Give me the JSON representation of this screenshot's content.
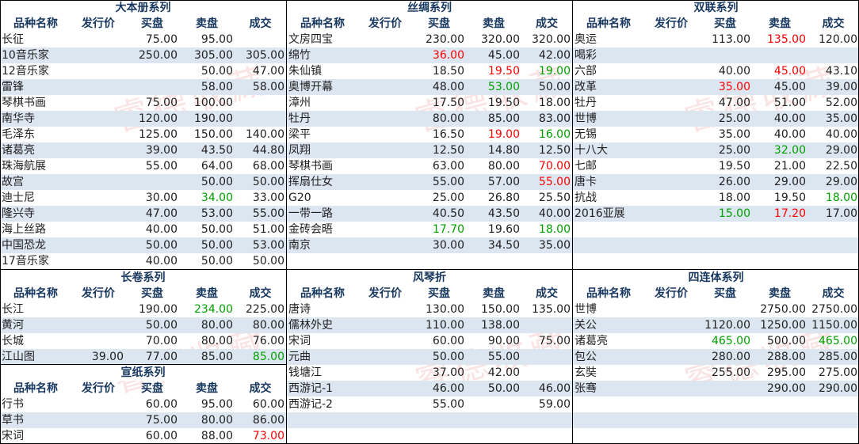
{
  "headers": {
    "name": "品种名称",
    "issue": "发行价",
    "buy": "买盘",
    "sell": "卖盘",
    "deal": "成交"
  },
  "watermark": "睿德收藏",
  "colors": {
    "header_text": "#17375e",
    "alt_row": "#dce6f1",
    "red": "#ff0000",
    "green": "#00a000"
  },
  "sections": [
    {
      "title": "大本册系列",
      "rows": [
        [
          "长征",
          "",
          "75.00",
          "95.00",
          ""
        ],
        [
          "10音乐家",
          "",
          "250.00",
          "305.00",
          "305.00"
        ],
        [
          "12音乐家",
          "",
          "",
          "50.00",
          "47.00"
        ],
        [
          "雷锋",
          "",
          "",
          "58.00",
          "58.00"
        ],
        [
          "琴棋书画",
          "",
          "75.00",
          "100.00",
          ""
        ],
        [
          "南华寺",
          "",
          "120.00",
          "190.00",
          ""
        ],
        [
          "毛泽东",
          "",
          "125.00",
          "150.00",
          "140.00"
        ],
        [
          "诸葛亮",
          "",
          "39.00",
          "43.50",
          "44.80"
        ],
        [
          "珠海航展",
          "",
          "55.00",
          "64.00",
          "68.00"
        ],
        [
          "故宫",
          "",
          "",
          "50.00",
          "50.00"
        ],
        [
          "迪士尼",
          "",
          "30.00",
          "34.00",
          "33.00"
        ],
        [
          "隆兴寺",
          "",
          "47.00",
          "53.00",
          "55.00"
        ],
        [
          "海上丝路",
          "",
          "40.00",
          "50.00",
          "51.00"
        ],
        [
          "中国恐龙",
          "",
          "50.00",
          "50.00",
          "53.00"
        ],
        [
          "17音乐家",
          "",
          "40.00",
          "50.00",
          "50.00"
        ]
      ],
      "colors": {
        "10-3": "green"
      }
    },
    {
      "title": "丝绸系列",
      "rows": [
        [
          "文房四宝",
          "",
          "230.00",
          "320.00",
          "320.00"
        ],
        [
          "绵竹",
          "",
          "36.00",
          "45.00",
          "42.00"
        ],
        [
          "朱仙镇",
          "",
          "18.50",
          "19.50",
          "19.00"
        ],
        [
          "奥博开幕",
          "",
          "48.00",
          "53.00",
          "50.00"
        ],
        [
          "漳州",
          "",
          "17.50",
          "19.50",
          "18.00"
        ],
        [
          "牡丹",
          "",
          "80.00",
          "85.00",
          "83.00"
        ],
        [
          "梁平",
          "",
          "16.50",
          "19.00",
          "16.00"
        ],
        [
          "凤翔",
          "",
          "12.50",
          "14.80",
          "12.50"
        ],
        [
          "琴棋书画",
          "",
          "63.00",
          "80.00",
          "70.00"
        ],
        [
          "挥扇仕女",
          "",
          "55.00",
          "57.00",
          "55.00"
        ],
        [
          "G20",
          "",
          "25.00",
          "26.80",
          "25.50"
        ],
        [
          "一带一路",
          "",
          "40.50",
          "43.50",
          "40.00"
        ],
        [
          "金砖会晤",
          "",
          "17.70",
          "19.60",
          "18.00"
        ],
        [
          "南京",
          "",
          "30.00",
          "34.50",
          "35.00"
        ]
      ],
      "colors": {
        "1-2": "red",
        "2-3": "red",
        "2-4": "green",
        "3-3": "green",
        "6-3": "red",
        "6-4": "green",
        "8-4": "red",
        "9-4": "red",
        "12-2": "green",
        "12-4": "green"
      }
    },
    {
      "title": "双联系列",
      "rows": [
        [
          "奥运",
          "",
          "113.00",
          "135.00",
          "120.00"
        ],
        [
          "喝彩",
          "",
          "",
          "",
          ""
        ],
        [
          "六部",
          "",
          "40.00",
          "45.00",
          "43.10"
        ],
        [
          "改革",
          "",
          "35.00",
          "45.00",
          "39.00"
        ],
        [
          "牡丹",
          "",
          "47.00",
          "51.00",
          "52.00"
        ],
        [
          "世博",
          "",
          "25.00",
          "40.00",
          "35.00"
        ],
        [
          "无锡",
          "",
          "35.00",
          "40.00",
          "40.00"
        ],
        [
          "十八大",
          "",
          "25.00",
          "32.00",
          "29.00"
        ],
        [
          "七邮",
          "",
          "19.50",
          "21.00",
          "22.50"
        ],
        [
          "唐卡",
          "",
          "26.00",
          "29.00",
          "29.00"
        ],
        [
          "抗战",
          "",
          "18.00",
          "19.50",
          "18.00"
        ],
        [
          "2016亚展",
          "",
          "15.00",
          "17.20",
          "17.00"
        ]
      ],
      "colors": {
        "0-3": "red",
        "2-3": "red",
        "3-2": "red",
        "7-3": "green",
        "10-4": "green",
        "11-2": "green",
        "11-3": "red"
      }
    },
    {
      "title": "长卷系列",
      "rows": [
        [
          "长江",
          "",
          "190.00",
          "234.00",
          "225.00"
        ],
        [
          "黄河",
          "",
          "50.00",
          "80.00",
          "80.00"
        ],
        [
          "长城",
          "",
          "70.00",
          "80.00",
          "76.00"
        ],
        [
          "江山图",
          "39.00",
          "77.00",
          "85.00",
          "85.00"
        ]
      ],
      "colors": {
        "0-3": "green",
        "3-4": "green"
      }
    },
    {
      "title": "宣纸系列",
      "rows": [
        [
          "行书",
          "",
          "60.00",
          "95.00",
          "60.00"
        ],
        [
          "草书",
          "",
          "75.00",
          "80.00",
          "86.00"
        ],
        [
          "宋词",
          "",
          "60.00",
          "88.00",
          "73.00"
        ]
      ],
      "colors": {
        "2-4": "red"
      }
    },
    {
      "title": "风琴折",
      "rows": [
        [
          "唐诗",
          "",
          "130.00",
          "150.00",
          "135.00"
        ],
        [
          "儒林外史",
          "",
          "110.00",
          "138.00",
          ""
        ],
        [
          "宋词",
          "",
          "60.00",
          "90.00",
          "75.00"
        ],
        [
          "元曲",
          "",
          "50.00",
          "55.00",
          ""
        ],
        [
          "钱塘江",
          "",
          "37.00",
          "42.00",
          ""
        ],
        [
          "西游记-1",
          "",
          "46.00",
          "50.00",
          "46.00"
        ],
        [
          "西游记-2",
          "",
          "55.00",
          "",
          "59.00"
        ]
      ],
      "colors": {}
    },
    {
      "title": "四连体系列",
      "rows": [
        [
          "世博",
          "",
          "",
          "2750.00",
          "2750.00"
        ],
        [
          "关公",
          "",
          "1120.00",
          "1250.00",
          "1150.00"
        ],
        [
          "诸葛亮",
          "",
          "465.00",
          "500.00",
          "465.00"
        ],
        [
          "包公",
          "",
          "280.00",
          "288.00",
          "285.00"
        ],
        [
          "玄奘",
          "",
          "255.00",
          "295.00",
          "275.00"
        ],
        [
          "张骞",
          "",
          "",
          "290.00",
          "290.00"
        ]
      ],
      "colors": {
        "2-2": "green",
        "2-4": "green"
      }
    }
  ]
}
